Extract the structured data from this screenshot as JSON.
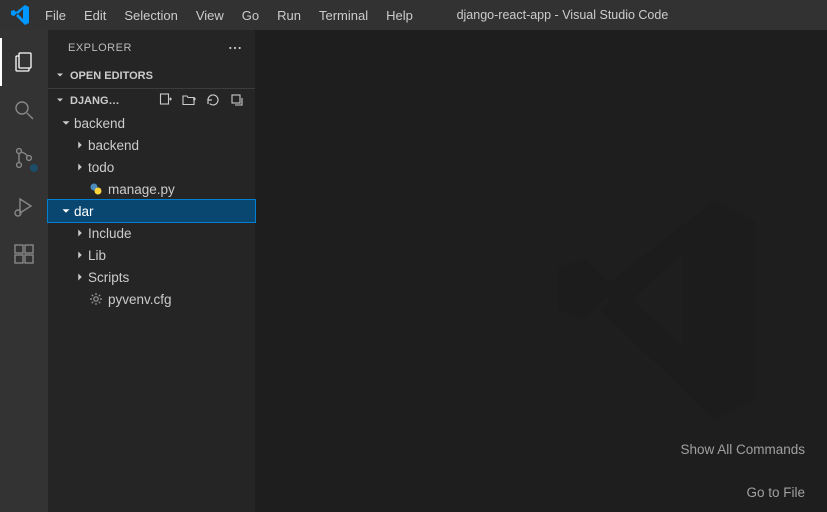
{
  "title": "django-react-app - Visual Studio Code",
  "menus": [
    "File",
    "Edit",
    "Selection",
    "View",
    "Go",
    "Run",
    "Terminal",
    "Help"
  ],
  "explorer": {
    "title": "EXPLORER"
  },
  "sections": {
    "openEditors": "OPEN EDITORS",
    "project": "DJANG…"
  },
  "tree": [
    {
      "type": "folder",
      "name": "backend",
      "depth": 0,
      "open": true,
      "selected": false
    },
    {
      "type": "folder",
      "name": "backend",
      "depth": 1,
      "open": false,
      "selected": false
    },
    {
      "type": "folder",
      "name": "todo",
      "depth": 1,
      "open": false,
      "selected": false
    },
    {
      "type": "file",
      "name": "manage.py",
      "depth": 1,
      "icon": "python",
      "selected": false
    },
    {
      "type": "folder",
      "name": "dar",
      "depth": 0,
      "open": true,
      "selected": true
    },
    {
      "type": "folder",
      "name": "Include",
      "depth": 1,
      "open": false,
      "selected": false
    },
    {
      "type": "folder",
      "name": "Lib",
      "depth": 1,
      "open": false,
      "selected": false
    },
    {
      "type": "folder",
      "name": "Scripts",
      "depth": 1,
      "open": false,
      "selected": false
    },
    {
      "type": "file",
      "name": "pyvenv.cfg",
      "depth": 1,
      "icon": "gear",
      "selected": false
    }
  ],
  "hints": {
    "showAll": "Show All Commands",
    "goToFile": "Go to File"
  }
}
